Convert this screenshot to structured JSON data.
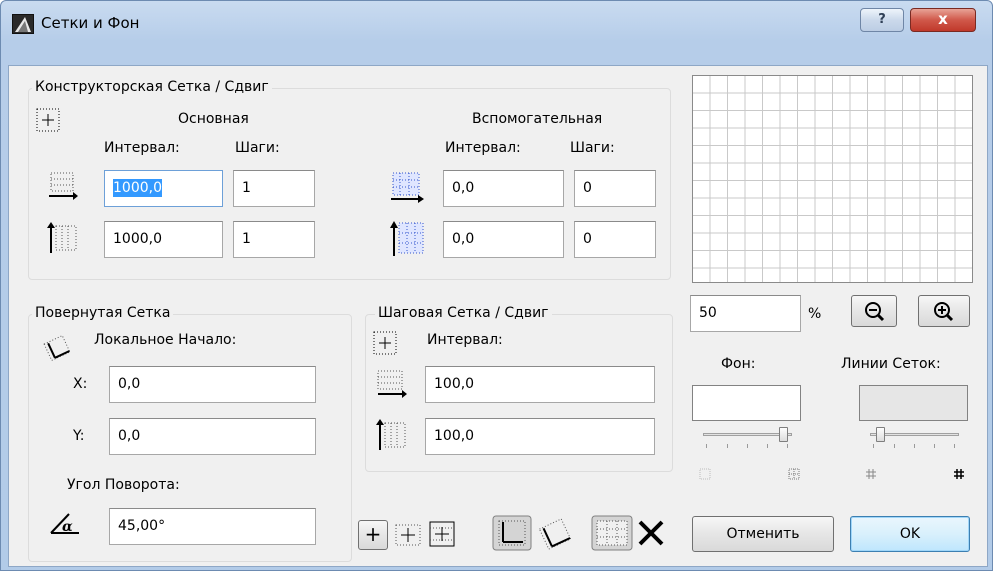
{
  "window": {
    "title": "Сетки и Фон",
    "help_label": "?",
    "close_label": "x"
  },
  "construction_grid": {
    "group_label": "Конструкторская Сетка / Сдвиг",
    "main": {
      "header": "Основная",
      "interval_label": "Интервал:",
      "steps_label": "Шаги:",
      "x_interval": "1000,0",
      "x_steps": "1",
      "y_interval": "1000,0",
      "y_steps": "1"
    },
    "auxiliary": {
      "header": "Вспомогательная",
      "interval_label": "Интервал:",
      "steps_label": "Шаги:",
      "x_interval": "0,0",
      "x_steps": "0",
      "y_interval": "0,0",
      "y_steps": "0"
    }
  },
  "rotated_grid": {
    "group_label": "Повернутая Сетка",
    "local_origin_label": "Локальное Начало:",
    "x_label": "X:",
    "x_value": "0,0",
    "y_label": "Y:",
    "y_value": "0,0",
    "angle_label": "Угол Поворота:",
    "angle_value": "45,00°"
  },
  "snap_grid": {
    "group_label": "Шаговая Сетка / Сдвиг",
    "interval_label": "Интервал:",
    "x_value": "100,0",
    "y_value": "100,0"
  },
  "preview": {
    "zoom_value": "50",
    "zoom_unit": "%",
    "background_label": "Фон:",
    "grid_lines_label": "Линии Сеток:",
    "background_color": "#ffffff",
    "grid_lines_color": "#e6e6e6",
    "background_slider_level": 0.95,
    "grid_lines_slider_level": 0.08
  },
  "buttons": {
    "cancel": "Отменить",
    "ok": "OK",
    "plus": "+"
  }
}
